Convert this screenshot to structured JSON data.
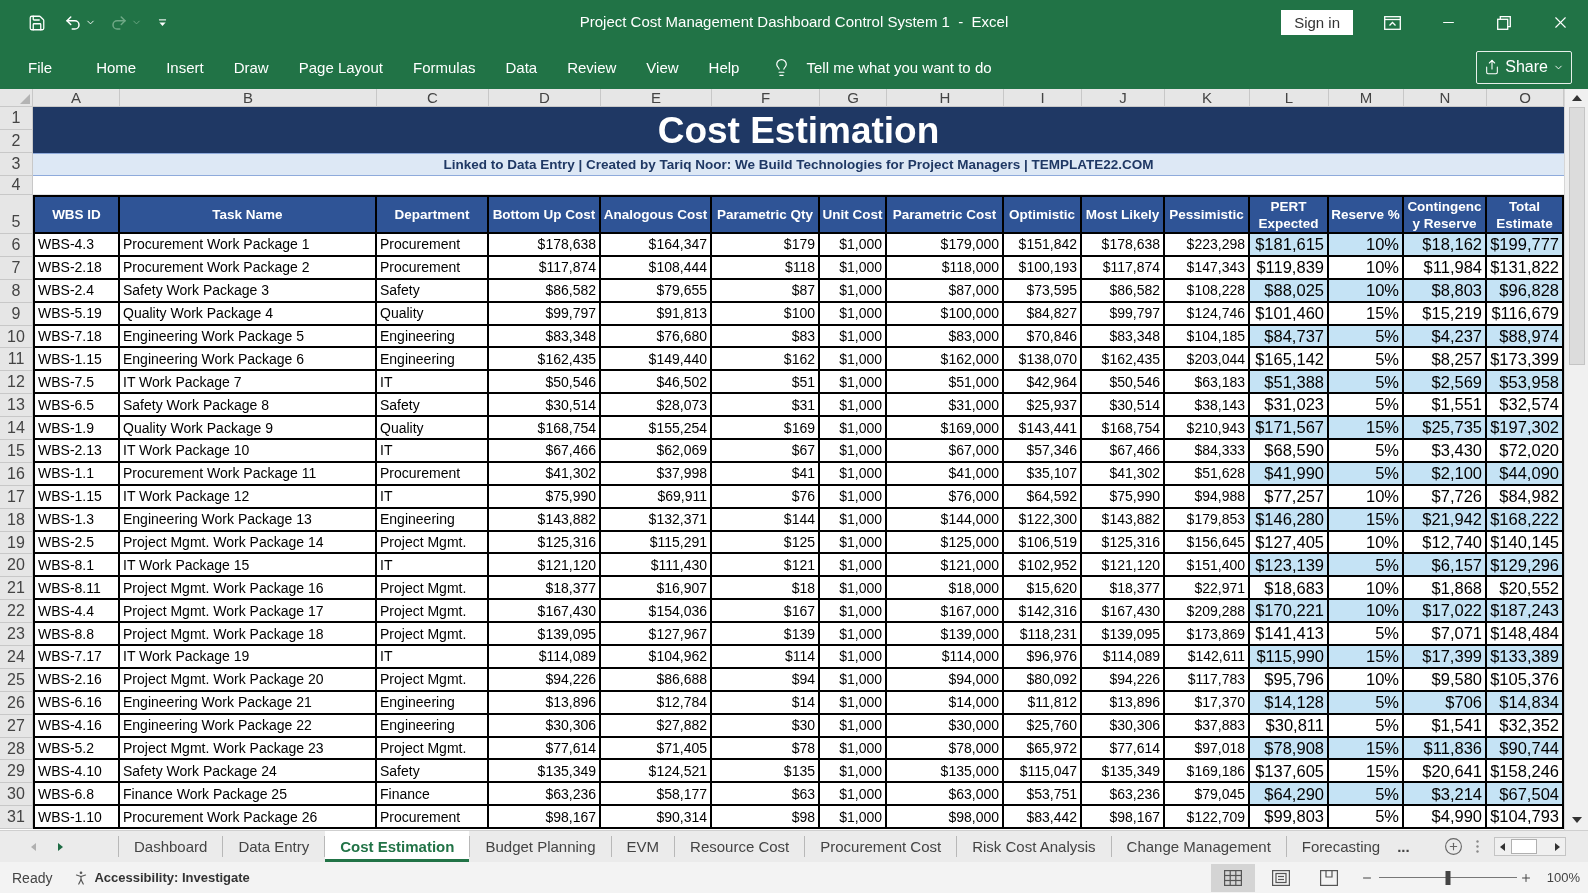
{
  "title_bar": {
    "title": "Project Cost Management Dashboard Control System 1  -  Excel",
    "sign_in": "Sign in"
  },
  "ribbon_tabs": [
    "File",
    "Home",
    "Insert",
    "Draw",
    "Page Layout",
    "Formulas",
    "Data",
    "Review",
    "View",
    "Help"
  ],
  "tell_me": "Tell me what you want to do",
  "share": "Share",
  "sheet": {
    "column_letters": [
      "A",
      "B",
      "C",
      "D",
      "E",
      "F",
      "G",
      "H",
      "I",
      "J",
      "K",
      "L",
      "M",
      "N",
      "O"
    ],
    "title": {
      "rows": [
        "1",
        "2"
      ],
      "text": "Cost Estimation"
    },
    "subtitle": {
      "row": "3",
      "text": "Linked to Data Entry | Created by Tariq Noor: We Build Technologies for Project Managers | TEMPLATE22.COM"
    },
    "blank_row": "4",
    "header": {
      "row": "5",
      "columns": [
        "WBS ID",
        "Task Name",
        "Department",
        "Bottom Up Cost",
        "Analogous Cost",
        "Parametric Qty",
        "Unit Cost",
        "Parametric Cost",
        "Optimistic",
        "Most Likely",
        "Pessimistic",
        "PERT Expected",
        "Reserve %",
        "Contingency Reserve",
        "Total Estimate"
      ]
    },
    "rows": [
      {
        "row": "6",
        "shaded": true,
        "cells": [
          "WBS-4.3",
          "Procurement Work Package 1",
          "Procurement",
          "$178,638",
          "$164,347",
          "$179",
          "$1,000",
          "$179,000",
          "$151,842",
          "$178,638",
          "$223,298",
          "$181,615",
          "10%",
          "$18,162",
          "$199,777"
        ]
      },
      {
        "row": "7",
        "shaded": false,
        "cells": [
          "WBS-2.18",
          "Procurement Work Package 2",
          "Procurement",
          "$117,874",
          "$108,444",
          "$118",
          "$1,000",
          "$118,000",
          "$100,193",
          "$117,874",
          "$147,343",
          "$119,839",
          "10%",
          "$11,984",
          "$131,822"
        ]
      },
      {
        "row": "8",
        "shaded": true,
        "cells": [
          "WBS-2.4",
          "Safety Work Package 3",
          "Safety",
          "$86,582",
          "$79,655",
          "$87",
          "$1,000",
          "$87,000",
          "$73,595",
          "$86,582",
          "$108,228",
          "$88,025",
          "10%",
          "$8,803",
          "$96,828"
        ]
      },
      {
        "row": "9",
        "shaded": false,
        "cells": [
          "WBS-5.19",
          "Quality Work Package 4",
          "Quality",
          "$99,797",
          "$91,813",
          "$100",
          "$1,000",
          "$100,000",
          "$84,827",
          "$99,797",
          "$124,746",
          "$101,460",
          "15%",
          "$15,219",
          "$116,679"
        ]
      },
      {
        "row": "10",
        "shaded": true,
        "cells": [
          "WBS-7.18",
          "Engineering Work Package 5",
          "Engineering",
          "$83,348",
          "$76,680",
          "$83",
          "$1,000",
          "$83,000",
          "$70,846",
          "$83,348",
          "$104,185",
          "$84,737",
          "5%",
          "$4,237",
          "$88,974"
        ]
      },
      {
        "row": "11",
        "shaded": false,
        "cells": [
          "WBS-1.15",
          "Engineering Work Package 6",
          "Engineering",
          "$162,435",
          "$149,440",
          "$162",
          "$1,000",
          "$162,000",
          "$138,070",
          "$162,435",
          "$203,044",
          "$165,142",
          "5%",
          "$8,257",
          "$173,399"
        ]
      },
      {
        "row": "12",
        "shaded": true,
        "cells": [
          "WBS-7.5",
          "IT Work Package 7",
          "IT",
          "$50,546",
          "$46,502",
          "$51",
          "$1,000",
          "$51,000",
          "$42,964",
          "$50,546",
          "$63,183",
          "$51,388",
          "5%",
          "$2,569",
          "$53,958"
        ]
      },
      {
        "row": "13",
        "shaded": false,
        "cells": [
          "WBS-6.5",
          "Safety Work Package 8",
          "Safety",
          "$30,514",
          "$28,073",
          "$31",
          "$1,000",
          "$31,000",
          "$25,937",
          "$30,514",
          "$38,143",
          "$31,023",
          "5%",
          "$1,551",
          "$32,574"
        ]
      },
      {
        "row": "14",
        "shaded": true,
        "cells": [
          "WBS-1.9",
          "Quality Work Package 9",
          "Quality",
          "$168,754",
          "$155,254",
          "$169",
          "$1,000",
          "$169,000",
          "$143,441",
          "$168,754",
          "$210,943",
          "$171,567",
          "15%",
          "$25,735",
          "$197,302"
        ]
      },
      {
        "row": "15",
        "shaded": false,
        "cells": [
          "WBS-2.13",
          "IT Work Package 10",
          "IT",
          "$67,466",
          "$62,069",
          "$67",
          "$1,000",
          "$67,000",
          "$57,346",
          "$67,466",
          "$84,333",
          "$68,590",
          "5%",
          "$3,430",
          "$72,020"
        ]
      },
      {
        "row": "16",
        "shaded": true,
        "cells": [
          "WBS-1.1",
          "Procurement Work Package 11",
          "Procurement",
          "$41,302",
          "$37,998",
          "$41",
          "$1,000",
          "$41,000",
          "$35,107",
          "$41,302",
          "$51,628",
          "$41,990",
          "5%",
          "$2,100",
          "$44,090"
        ]
      },
      {
        "row": "17",
        "shaded": false,
        "cells": [
          "WBS-1.15",
          "IT Work Package 12",
          "IT",
          "$75,990",
          "$69,911",
          "$76",
          "$1,000",
          "$76,000",
          "$64,592",
          "$75,990",
          "$94,988",
          "$77,257",
          "10%",
          "$7,726",
          "$84,982"
        ]
      },
      {
        "row": "18",
        "shaded": true,
        "cells": [
          "WBS-1.3",
          "Engineering Work Package 13",
          "Engineering",
          "$143,882",
          "$132,371",
          "$144",
          "$1,000",
          "$144,000",
          "$122,300",
          "$143,882",
          "$179,853",
          "$146,280",
          "15%",
          "$21,942",
          "$168,222"
        ]
      },
      {
        "row": "19",
        "shaded": false,
        "cells": [
          "WBS-2.5",
          "Project Mgmt. Work Package 14",
          "Project Mgmt.",
          "$125,316",
          "$115,291",
          "$125",
          "$1,000",
          "$125,000",
          "$106,519",
          "$125,316",
          "$156,645",
          "$127,405",
          "10%",
          "$12,740",
          "$140,145"
        ]
      },
      {
        "row": "20",
        "shaded": true,
        "cells": [
          "WBS-8.1",
          "IT Work Package 15",
          "IT",
          "$121,120",
          "$111,430",
          "$121",
          "$1,000",
          "$121,000",
          "$102,952",
          "$121,120",
          "$151,400",
          "$123,139",
          "5%",
          "$6,157",
          "$129,296"
        ]
      },
      {
        "row": "21",
        "shaded": false,
        "cells": [
          "WBS-8.11",
          "Project Mgmt. Work Package 16",
          "Project Mgmt.",
          "$18,377",
          "$16,907",
          "$18",
          "$1,000",
          "$18,000",
          "$15,620",
          "$18,377",
          "$22,971",
          "$18,683",
          "10%",
          "$1,868",
          "$20,552"
        ]
      },
      {
        "row": "22",
        "shaded": true,
        "cells": [
          "WBS-4.4",
          "Project Mgmt. Work Package 17",
          "Project Mgmt.",
          "$167,430",
          "$154,036",
          "$167",
          "$1,000",
          "$167,000",
          "$142,316",
          "$167,430",
          "$209,288",
          "$170,221",
          "10%",
          "$17,022",
          "$187,243"
        ]
      },
      {
        "row": "23",
        "shaded": false,
        "cells": [
          "WBS-8.8",
          "Project Mgmt. Work Package 18",
          "Project Mgmt.",
          "$139,095",
          "$127,967",
          "$139",
          "$1,000",
          "$139,000",
          "$118,231",
          "$139,095",
          "$173,869",
          "$141,413",
          "5%",
          "$7,071",
          "$148,484"
        ]
      },
      {
        "row": "24",
        "shaded": true,
        "cells": [
          "WBS-7.17",
          "IT Work Package 19",
          "IT",
          "$114,089",
          "$104,962",
          "$114",
          "$1,000",
          "$114,000",
          "$96,976",
          "$114,089",
          "$142,611",
          "$115,990",
          "15%",
          "$17,399",
          "$133,389"
        ]
      },
      {
        "row": "25",
        "shaded": false,
        "cells": [
          "WBS-2.16",
          "Project Mgmt. Work Package 20",
          "Project Mgmt.",
          "$94,226",
          "$86,688",
          "$94",
          "$1,000",
          "$94,000",
          "$80,092",
          "$94,226",
          "$117,783",
          "$95,796",
          "10%",
          "$9,580",
          "$105,376"
        ]
      },
      {
        "row": "26",
        "shaded": true,
        "cells": [
          "WBS-6.16",
          "Engineering Work Package 21",
          "Engineering",
          "$13,896",
          "$12,784",
          "$14",
          "$1,000",
          "$14,000",
          "$11,812",
          "$13,896",
          "$17,370",
          "$14,128",
          "5%",
          "$706",
          "$14,834"
        ]
      },
      {
        "row": "27",
        "shaded": false,
        "cells": [
          "WBS-4.16",
          "Engineering Work Package 22",
          "Engineering",
          "$30,306",
          "$27,882",
          "$30",
          "$1,000",
          "$30,000",
          "$25,760",
          "$30,306",
          "$37,883",
          "$30,811",
          "5%",
          "$1,541",
          "$32,352"
        ]
      },
      {
        "row": "28",
        "shaded": true,
        "cells": [
          "WBS-5.2",
          "Project Mgmt. Work Package 23",
          "Project Mgmt.",
          "$77,614",
          "$71,405",
          "$78",
          "$1,000",
          "$78,000",
          "$65,972",
          "$77,614",
          "$97,018",
          "$78,908",
          "15%",
          "$11,836",
          "$90,744"
        ]
      },
      {
        "row": "29",
        "shaded": false,
        "cells": [
          "WBS-4.10",
          "Safety Work Package 24",
          "Safety",
          "$135,349",
          "$124,521",
          "$135",
          "$1,000",
          "$135,000",
          "$115,047",
          "$135,349",
          "$169,186",
          "$137,605",
          "15%",
          "$20,641",
          "$158,246"
        ]
      },
      {
        "row": "30",
        "shaded": true,
        "cells": [
          "WBS-6.8",
          "Finance Work Package 25",
          "Finance",
          "$63,236",
          "$58,177",
          "$63",
          "$1,000",
          "$63,000",
          "$53,751",
          "$63,236",
          "$79,045",
          "$64,290",
          "5%",
          "$3,214",
          "$67,504"
        ]
      },
      {
        "row": "31",
        "shaded": false,
        "cells": [
          "WBS-1.10",
          "Procurement Work Package 26",
          "Procurement",
          "$98,167",
          "$90,314",
          "$98",
          "$1,000",
          "$98,000",
          "$83,442",
          "$98,167",
          "$122,709",
          "$99,803",
          "5%",
          "$4,990",
          "$104,793"
        ]
      }
    ]
  },
  "sheet_tabs": {
    "tabs": [
      {
        "label": "Dashboard",
        "selected": false
      },
      {
        "label": "Data Entry",
        "selected": false
      },
      {
        "label": "Cost Estimation",
        "selected": true
      },
      {
        "label": "Budget Planning",
        "selected": false
      },
      {
        "label": "EVM",
        "selected": false
      },
      {
        "label": "Resource Cost",
        "selected": false
      },
      {
        "label": "Procurement Cost",
        "selected": false
      },
      {
        "label": "Risk Cost Analysis",
        "selected": false
      },
      {
        "label": "Change Management",
        "selected": false
      },
      {
        "label": "Forecasting",
        "selected": false
      }
    ],
    "overflow": "..."
  },
  "status_bar": {
    "status": "Ready",
    "accessibility": "Accessibility: Investigate",
    "views": [
      {
        "kind": "normal",
        "selected": true
      },
      {
        "kind": "page_layout",
        "selected": false
      },
      {
        "kind": "page_break",
        "selected": false
      }
    ],
    "zoom": {
      "level": 0.5,
      "reading": "100%"
    }
  }
}
